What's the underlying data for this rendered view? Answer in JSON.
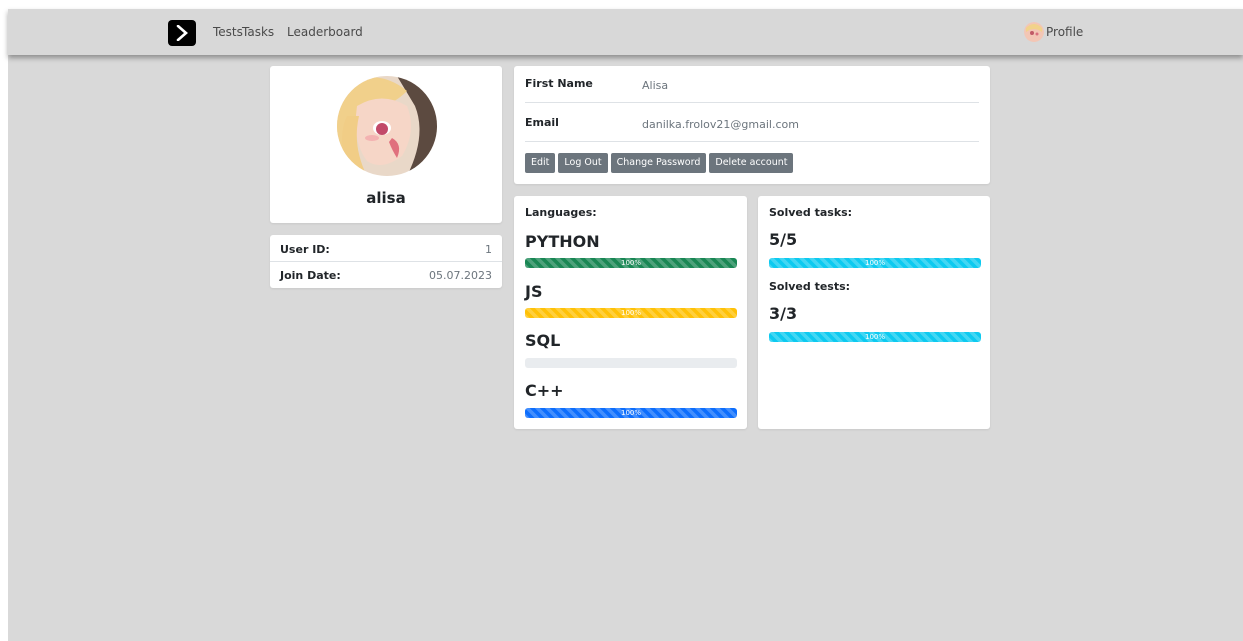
{
  "nav": {
    "links": [
      "Tests",
      "Tasks",
      "Leaderboard"
    ],
    "profile_label": "Profile"
  },
  "user_card": {
    "username": "alisa"
  },
  "meta": {
    "user_id_label": "User ID:",
    "user_id": "1",
    "join_date_label": "Join Date:",
    "join_date": "05.07.2023"
  },
  "details": {
    "first_name_label": "First Name",
    "first_name": "Alisa",
    "email_label": "Email",
    "email": "danilka.frolov21@gmail.com",
    "buttons": [
      "Edit",
      "Log Out",
      "Change Password",
      "Delete account"
    ]
  },
  "languages": {
    "title": "Languages:",
    "items": [
      {
        "name": "PYTHON",
        "progress": 100,
        "label": "100%",
        "color": "#198754"
      },
      {
        "name": "JS",
        "progress": 100,
        "label": "100%",
        "color": "#ffc107"
      },
      {
        "name": "SQL",
        "progress": 0,
        "label": "",
        "color": "#e9ecef"
      },
      {
        "name": "C++",
        "progress": 100,
        "label": "100%",
        "color": "#0d6efd"
      }
    ]
  },
  "stats": {
    "tasks_title": "Solved tasks:",
    "tasks_value": "5/5",
    "tasks_progress": 100,
    "tasks_label": "100%",
    "tests_title": "Solved tests:",
    "tests_value": "3/3",
    "tests_progress": 100,
    "tests_label": "100%",
    "color": "#0dcaf0"
  }
}
